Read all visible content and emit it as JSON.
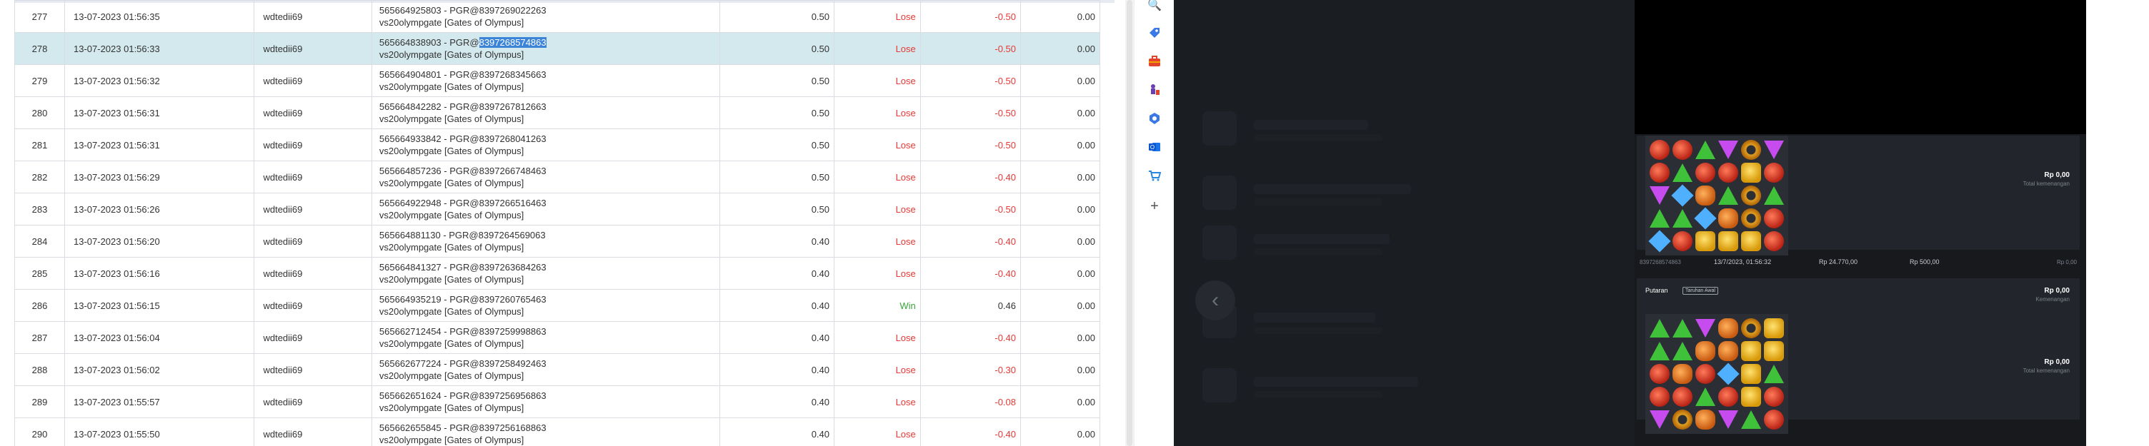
{
  "table": {
    "rows": [
      {
        "no": "277",
        "date": "13-07-2023 01:56:35",
        "user": "wdtedii69",
        "desc1": "565664925803 - PGR@8397269022263",
        "desc2": "vs20olympgate [Gates of Olympus]",
        "bet": "0.50",
        "result": "Lose",
        "amount": "-0.50",
        "balance": "0.00"
      },
      {
        "no": "278",
        "date": "13-07-2023 01:56:33",
        "user": "wdtedii69",
        "desc1_prefix": "565664838903 - PGR@",
        "desc1_highlight": "8397268574863",
        "desc2": "vs20olympgate [Gates of Olympus]",
        "bet": "0.50",
        "result": "Lose",
        "amount": "-0.50",
        "balance": "0.00"
      },
      {
        "no": "279",
        "date": "13-07-2023 01:56:32",
        "user": "wdtedii69",
        "desc1": "565664904801 - PGR@8397268345663",
        "desc2": "vs20olympgate [Gates of Olympus]",
        "bet": "0.50",
        "result": "Lose",
        "amount": "-0.50",
        "balance": "0.00"
      },
      {
        "no": "280",
        "date": "13-07-2023 01:56:31",
        "user": "wdtedii69",
        "desc1": "565664842282 - PGR@8397267812663",
        "desc2": "vs20olympgate [Gates of Olympus]",
        "bet": "0.50",
        "result": "Lose",
        "amount": "-0.50",
        "balance": "0.00"
      },
      {
        "no": "281",
        "date": "13-07-2023 01:56:31",
        "user": "wdtedii69",
        "desc1": "565664933842 - PGR@8397268041263",
        "desc2": "vs20olympgate [Gates of Olympus]",
        "bet": "0.50",
        "result": "Lose",
        "amount": "-0.50",
        "balance": "0.00"
      },
      {
        "no": "282",
        "date": "13-07-2023 01:56:29",
        "user": "wdtedii69",
        "desc1": "565664857236 - PGR@8397266748463",
        "desc2": "vs20olympgate [Gates of Olympus]",
        "bet": "0.50",
        "result": "Lose",
        "amount": "-0.40",
        "balance": "0.00"
      },
      {
        "no": "283",
        "date": "13-07-2023 01:56:26",
        "user": "wdtedii69",
        "desc1": "565664922948 - PGR@8397266516463",
        "desc2": "vs20olympgate [Gates of Olympus]",
        "bet": "0.50",
        "result": "Lose",
        "amount": "-0.50",
        "balance": "0.00"
      },
      {
        "no": "284",
        "date": "13-07-2023 01:56:20",
        "user": "wdtedii69",
        "desc1": "565664881130 - PGR@8397264569063",
        "desc2": "vs20olympgate [Gates of Olympus]",
        "bet": "0.40",
        "result": "Lose",
        "amount": "-0.40",
        "balance": "0.00"
      },
      {
        "no": "285",
        "date": "13-07-2023 01:56:16",
        "user": "wdtedii69",
        "desc1": "565664841327 - PGR@8397263684263",
        "desc2": "vs20olympgate [Gates of Olympus]",
        "bet": "0.40",
        "result": "Lose",
        "amount": "-0.40",
        "balance": "0.00"
      },
      {
        "no": "286",
        "date": "13-07-2023 01:56:15",
        "user": "wdtedii69",
        "desc1": "565664935219 - PGR@8397260765463",
        "desc2": "vs20olympgate [Gates of Olympus]",
        "bet": "0.40",
        "result": "Win",
        "amount": "0.46",
        "balance": "0.00"
      },
      {
        "no": "287",
        "date": "13-07-2023 01:56:04",
        "user": "wdtedii69",
        "desc1": "565662712454 - PGR@8397259998863",
        "desc2": "vs20olympgate [Gates of Olympus]",
        "bet": "0.40",
        "result": "Lose",
        "amount": "-0.40",
        "balance": "0.00"
      },
      {
        "no": "288",
        "date": "13-07-2023 01:56:02",
        "user": "wdtedii69",
        "desc1": "565662677224 - PGR@8397258492463",
        "desc2": "vs20olympgate [Gates of Olympus]",
        "bet": "0.40",
        "result": "Lose",
        "amount": "-0.30",
        "balance": "0.00"
      },
      {
        "no": "289",
        "date": "13-07-2023 01:55:57",
        "user": "wdtedii69",
        "desc1": "565662651624 - PGR@8397256956863",
        "desc2": "vs20olympgate [Gates of Olympus]",
        "bet": "0.40",
        "result": "Lose",
        "amount": "-0.08",
        "balance": "0.00"
      },
      {
        "no": "290",
        "date": "13-07-2023 01:55:50",
        "user": "wdtedii69",
        "desc1": "565662655845 - PGR@8397256168863",
        "desc2": "vs20olympgate [Gates of Olympus]",
        "bet": "0.40",
        "result": "Lose",
        "amount": "-0.40",
        "balance": "0.00"
      }
    ]
  },
  "sidebar_icons": [
    "search-icon",
    "tag-icon",
    "toolbox-icon",
    "chess-icon",
    "shield-icon",
    "outlook-icon",
    "shopping-cart-icon",
    "plus-icon"
  ],
  "game_history": {
    "card1": {
      "win_amount": "Rp 0,00",
      "win_label": "Total kemenangan"
    },
    "info_row": {
      "id": "8397268574863",
      "datetime": "13/7/2023, 01:56:32",
      "bet": "Rp 24.770,00",
      "stake": "Rp 500,00",
      "payout": "Rp 0,00"
    },
    "card2": {
      "title": "Putaran",
      "badge": "Taruhan Awal",
      "top_amount": "Rp 0,00",
      "top_label": "Kemenangan",
      "win_amount": "Rp 0,00",
      "win_label": "Total kemenangan"
    }
  },
  "colors": {
    "lose": "#e53935",
    "win": "#3aa33a",
    "selected_row": "#d4e9ee",
    "highlight": "#3b84d8",
    "dark_bg": "#1a1d22"
  }
}
